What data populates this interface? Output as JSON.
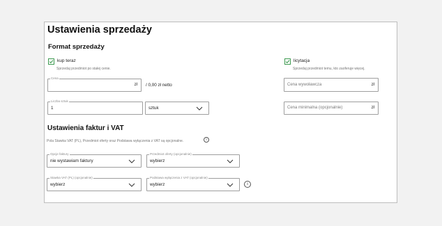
{
  "page": {
    "title": "Ustawienia sprzedaży"
  },
  "sales_format": {
    "heading": "Format sprzedaży",
    "buy_now": {
      "label": "kup teraz",
      "checked": true,
      "hint": "Sprzedaj przedmiot po stałej cenie."
    },
    "auction": {
      "label": "licytacja",
      "checked": true,
      "hint": "Sprzedaj przedmiot temu, kto zaoferuje więcej."
    },
    "price": {
      "label": "Cena",
      "value": "",
      "unit": "zł",
      "net_note": "/ 0,00 zł netto"
    },
    "quantity": {
      "label": "Liczba sztuk",
      "value": "1"
    },
    "quantity_unit": {
      "selected": "sztuk"
    },
    "starting_price": {
      "placeholder": "Cena wywoławcza",
      "unit": "zł"
    },
    "minimum_price": {
      "placeholder": "Cena minimalna (opcjonalnie)",
      "unit": "zł"
    }
  },
  "invoice_settings": {
    "heading": "Ustawienia faktur i VAT",
    "description": "Pola Stawka VAT (PL), Przedmiot oferty oraz Podstawa wyłączenia z VAT są opcjonalne.",
    "invoice_options": {
      "label": "Opcje faktury",
      "selected": "nie wystawiam faktury"
    },
    "offer_subject": {
      "label": "Przedmiot oferty (opcjonalnie)",
      "selected": "wybierz"
    },
    "vat_rate": {
      "label": "Stawka VAT (PL) (opcjonalnie)",
      "selected": "wybierz"
    },
    "vat_exemption": {
      "label": "Podstawa wyłączenia z VAT (opcjonalnie)",
      "selected": "wybierz"
    },
    "info_icon": "i"
  },
  "colors": {
    "checkbox_green": "#3d9a50",
    "border_gray": "#9e9e9e"
  }
}
